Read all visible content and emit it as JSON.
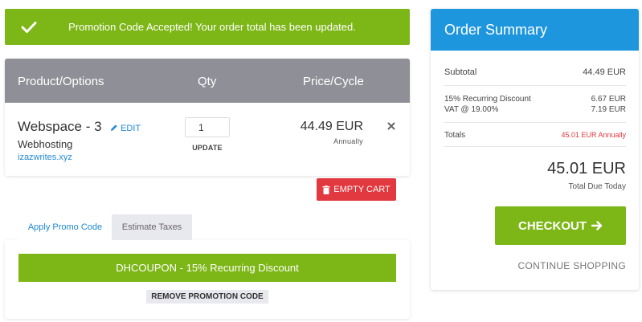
{
  "banner": {
    "icon": "check-icon",
    "message": "Promotion Code Accepted! Your order total has been updated."
  },
  "cart": {
    "columns": [
      "Product/Options",
      "Qty",
      "Price/Cycle"
    ],
    "item": {
      "name": "Webspace - 3",
      "edit_label": "EDIT",
      "group": "Webhosting",
      "domain": "izazwrites.xyz",
      "qty": "1",
      "update_label": "UPDATE",
      "price": "44.49 EUR",
      "cycle": "Annually",
      "remove_icon": "close-icon"
    },
    "empty_label": "EMPTY CART"
  },
  "promo": {
    "tabs": [
      "Apply Promo Code",
      "Estimate Taxes"
    ],
    "applied": "DHCOUPON - 15% Recurring Discount",
    "remove_label": "REMOVE PROMOTION CODE"
  },
  "summary": {
    "title": "Order Summary",
    "subtotal_label": "Subtotal",
    "subtotal_value": "44.49 EUR",
    "discount_label": "15% Recurring Discount",
    "discount_value": "6.67 EUR",
    "vat_label": "VAT @ 19.00%",
    "vat_value": "7.19 EUR",
    "totals_label": "Totals",
    "totals_value": "45.01 EUR Annually",
    "total_due": "45.01 EUR",
    "total_due_label": "Total Due Today",
    "checkout_label": "CHECKOUT",
    "continue_label": "CONTINUE SHOPPING"
  },
  "colors": {
    "success": "#7db617",
    "primary": "#1e96de",
    "danger": "#e2383f",
    "header_gray": "#8f9097",
    "total_red": "#e2383f"
  }
}
